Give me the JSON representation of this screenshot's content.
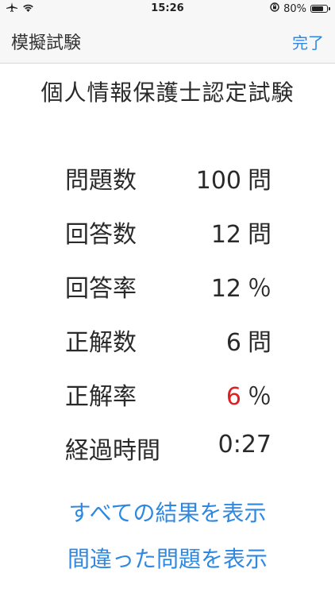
{
  "status_bar": {
    "time": "15:26",
    "battery_text": "80%",
    "battery_level": 0.8
  },
  "nav": {
    "title": "模擬試験",
    "done_label": "完了"
  },
  "exam": {
    "title": "個人情報保護士認定試験"
  },
  "stats": [
    {
      "label": "問題数",
      "value": "100",
      "unit": "問"
    },
    {
      "label": "回答数",
      "value": "12",
      "unit": "問"
    },
    {
      "label": "回答率",
      "value": "12",
      "unit": "％"
    },
    {
      "label": "正解数",
      "value": "6",
      "unit": "問"
    },
    {
      "label": "正解率",
      "value": "6",
      "unit": "％",
      "highlight": "#e02020"
    },
    {
      "label": "経過時間",
      "value": "0:27",
      "unit": ""
    }
  ],
  "links": {
    "show_all": "すべての結果を表示",
    "show_wrong": "間違った問題を表示"
  }
}
